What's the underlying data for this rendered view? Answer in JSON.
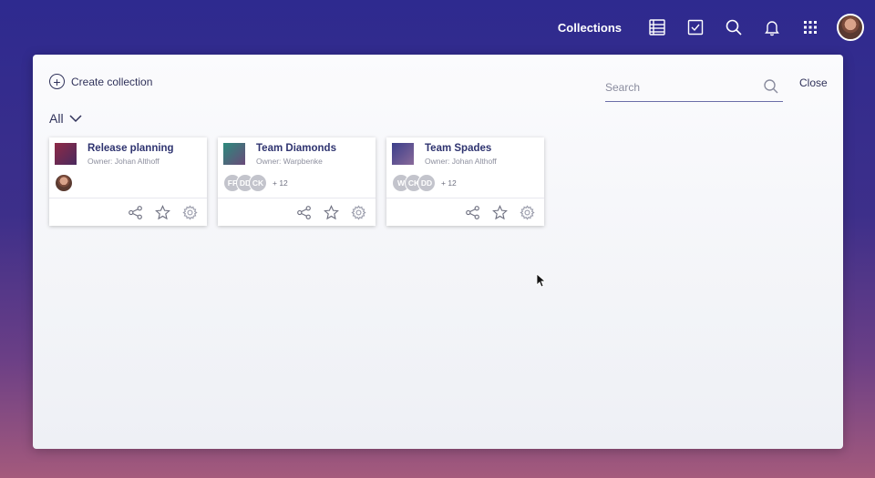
{
  "topbar": {
    "title": "Collections",
    "icons": [
      "list-icon",
      "checkbox-icon",
      "search-icon",
      "bell-icon",
      "apps-grid-icon"
    ]
  },
  "panel": {
    "create_label": "Create collection",
    "search_placeholder": "Search",
    "close_label": "Close",
    "filter_label": "All"
  },
  "cards": [
    {
      "title": "Release planning",
      "owner": "Owner: Johan Althoff",
      "thumb_colors": [
        "#8e2a46",
        "#4a2a5e"
      ],
      "members": [],
      "more": ""
    },
    {
      "title": "Team Diamonds",
      "owner": "Owner: Warpbenke",
      "thumb_colors": [
        "#2c8a7c",
        "#6a4a7a"
      ],
      "members": [
        "FF",
        "DD",
        "CK"
      ],
      "more": "+ 12"
    },
    {
      "title": "Team Spades",
      "owner": "Owner: Johan Althoff",
      "thumb_colors": [
        "#3a3e8a",
        "#8a6a9a"
      ],
      "members": [
        "W",
        "CK",
        "DD"
      ],
      "more": "+ 12"
    }
  ],
  "colors": {
    "text_dark": "#30325a",
    "title_blue": "#2f3470",
    "avatar_gray": "#c3c4cc"
  }
}
